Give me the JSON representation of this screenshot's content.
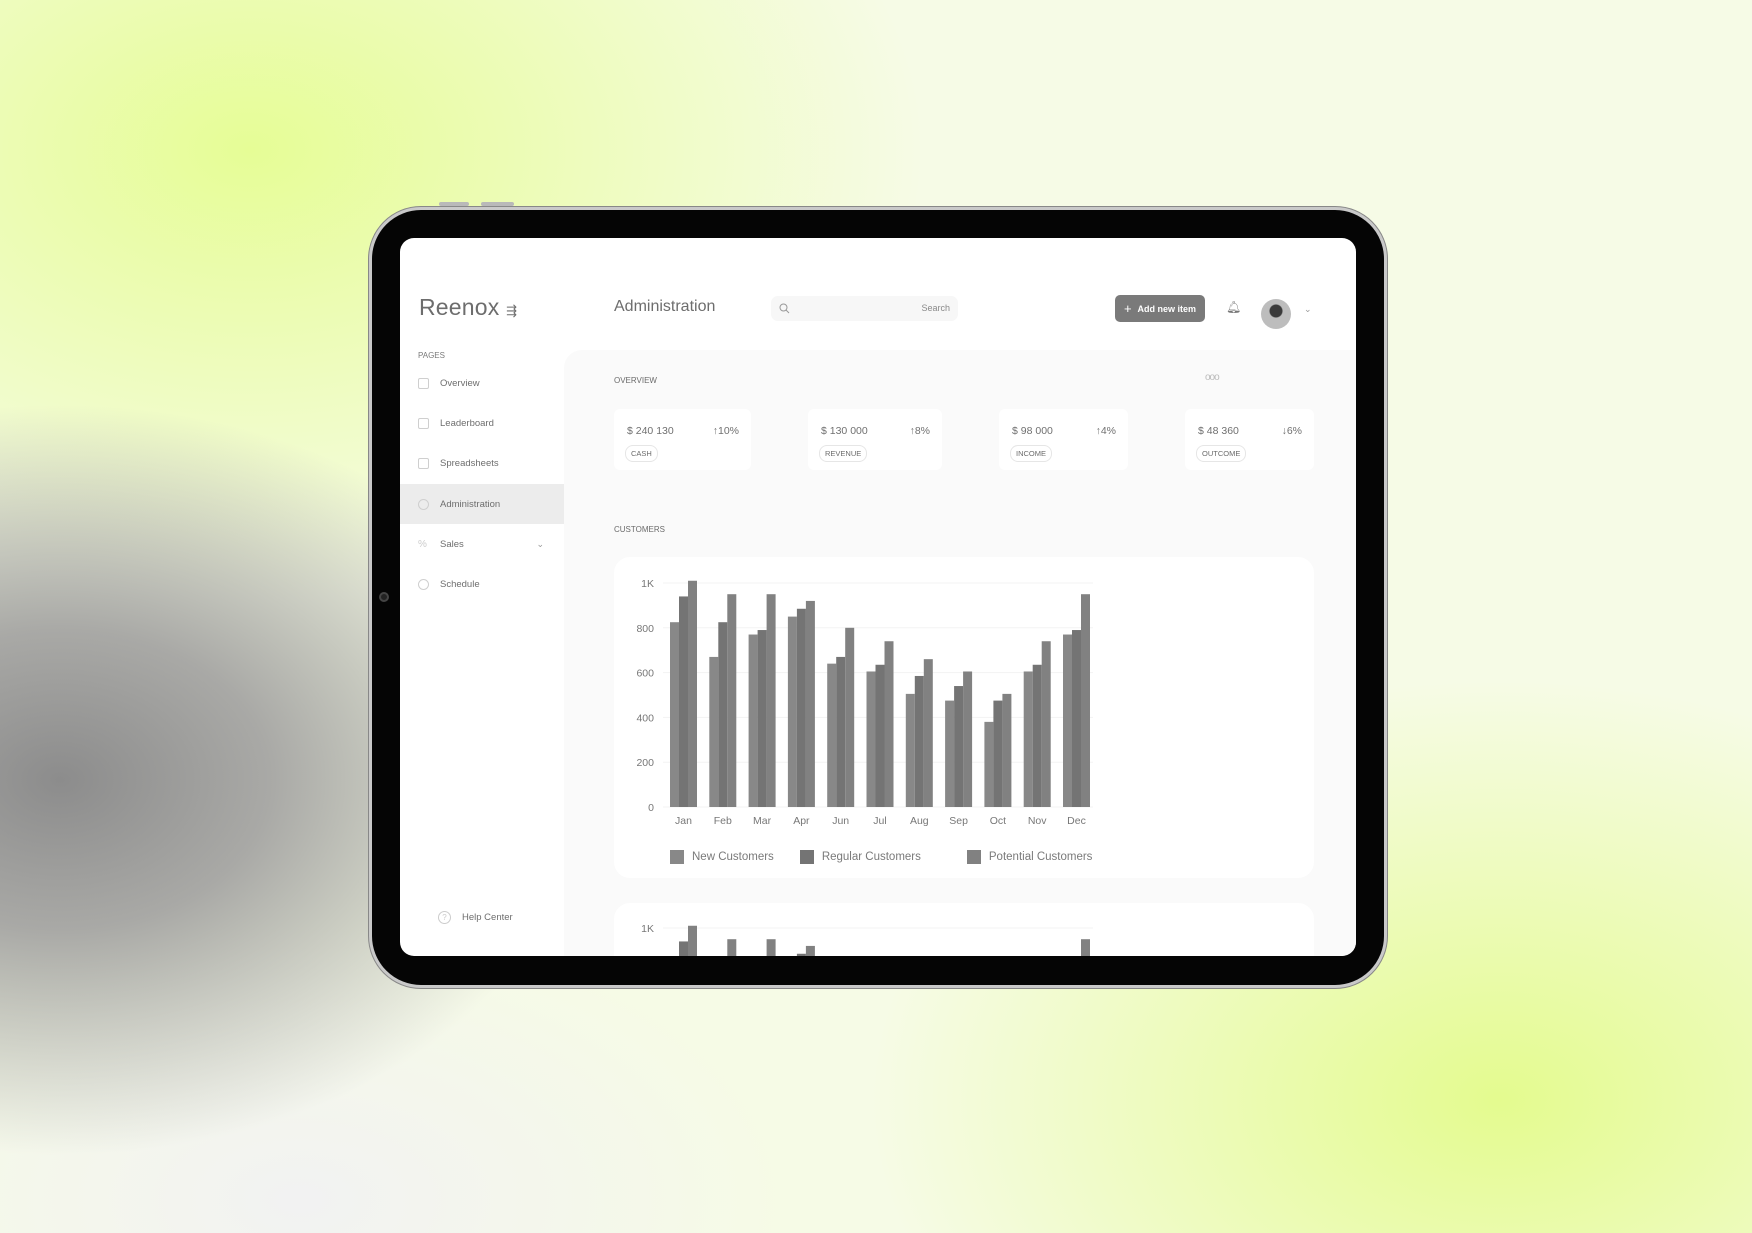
{
  "app": {
    "logo": "Reenox",
    "page_title": "Administration"
  },
  "header": {
    "search_placeholder": "Search",
    "add_button": "Add new item"
  },
  "sidebar": {
    "section": "PAGES",
    "items": [
      {
        "label": "Overview"
      },
      {
        "label": "Leaderboard"
      },
      {
        "label": "Spreadsheets"
      },
      {
        "label": "Administration",
        "active": true
      },
      {
        "label": "Sales",
        "has_submenu": true
      },
      {
        "label": "Schedule"
      }
    ],
    "help": "Help Center"
  },
  "overview": {
    "label": "OVERVIEW",
    "cards": [
      {
        "amount": "$ 240 130",
        "change": "↑10%",
        "tag": "CASH"
      },
      {
        "amount": "$ 130 000",
        "change": "↑8%",
        "tag": "REVENUE"
      },
      {
        "amount": "$ 98 000",
        "change": "↑4%",
        "tag": "INCOME"
      },
      {
        "amount": "$ 48 360",
        "change": "↓6%",
        "tag": "OUTCOME"
      }
    ]
  },
  "customers": {
    "label": "CUSTOMERS"
  },
  "chart_data": {
    "type": "bar",
    "categories": [
      "Jan",
      "Feb",
      "Mar",
      "Apr",
      "Jun",
      "Jul",
      "Aug",
      "Sep",
      "Oct",
      "Nov",
      "Dec"
    ],
    "yticks": [
      "0",
      "200",
      "400",
      "600",
      "800",
      "1K"
    ],
    "ylim": [
      0,
      1000
    ],
    "grid": true,
    "legend": "bottom",
    "series": [
      {
        "name": "New Customers",
        "color": "#888888",
        "values": [
          825,
          670,
          770,
          850,
          640,
          605,
          505,
          475,
          380,
          605,
          770
        ]
      },
      {
        "name": "Regular Customers",
        "color": "#747474",
        "values": [
          940,
          825,
          790,
          885,
          670,
          635,
          585,
          540,
          475,
          635,
          790
        ]
      },
      {
        "name": "Potential Customers",
        "color": "#818181",
        "values": [
          1010,
          950,
          950,
          920,
          800,
          740,
          660,
          605,
          505,
          740,
          950
        ]
      }
    ]
  }
}
